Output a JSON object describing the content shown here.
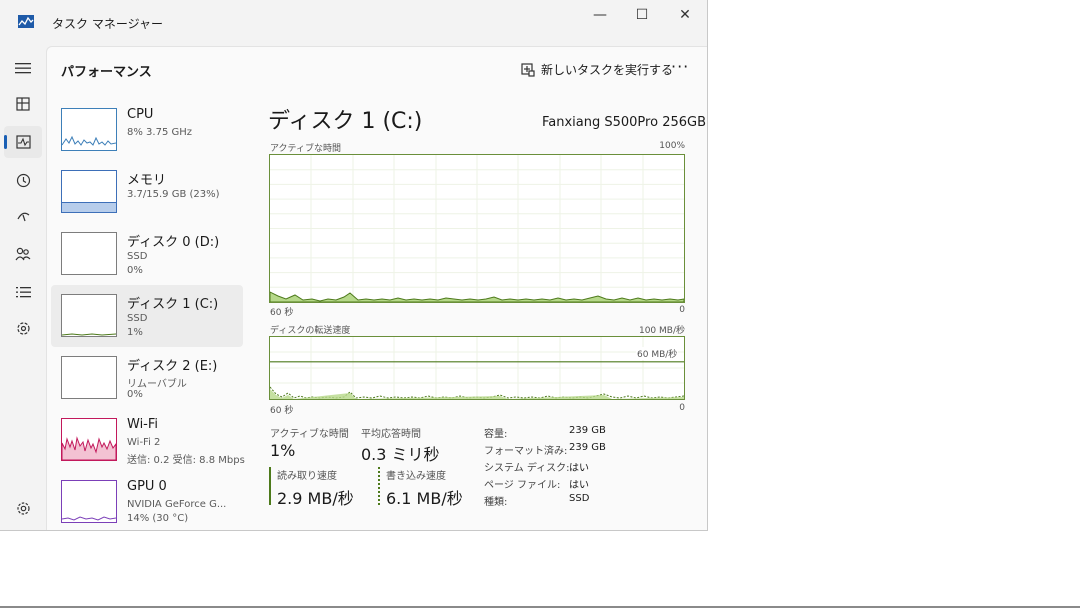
{
  "window": {
    "title": "タスク マネージャー",
    "minimize": "—",
    "maximize": "☐",
    "close": "✕"
  },
  "header": {
    "page_title": "パフォーマンス",
    "run_task_label": "新しいタスクを実行する",
    "more_label": "···"
  },
  "nav": {
    "items": [
      "menu-icon",
      "processes-icon",
      "performance-icon",
      "app-history-icon",
      "startup-icon",
      "users-icon",
      "details-icon",
      "services-icon",
      "settings-icon"
    ]
  },
  "sidebar": {
    "items": [
      {
        "name": "CPU",
        "sub1": "8%  3.75 GHz",
        "sub2": ""
      },
      {
        "name": "メモリ",
        "sub1": "3.7/15.9 GB (23%)",
        "sub2": ""
      },
      {
        "name": "ディスク 0 (D:)",
        "sub1": "SSD",
        "sub2": "0%"
      },
      {
        "name": "ディスク 1 (C:)",
        "sub1": "SSD",
        "sub2": "1%"
      },
      {
        "name": "ディスク 2 (E:)",
        "sub1": "リムーバブル",
        "sub2": "0%"
      },
      {
        "name": "Wi-Fi",
        "sub1": "Wi-Fi 2",
        "sub2": "送信: 0.2  受信: 8.8 Mbps"
      },
      {
        "name": "GPU 0",
        "sub1": "NVIDIA GeForce G...",
        "sub2": "14%  (30 °C)"
      }
    ]
  },
  "detail": {
    "title": "ディスク 1 (C:)",
    "model": "Fanxiang S500Pro 256GB",
    "graph1": {
      "label": "アクティブな時間",
      "max": "100%",
      "left": "60 秒",
      "right": "0"
    },
    "graph2": {
      "label": "ディスクの転送速度",
      "max": "100 MB/秒",
      "line_label": "60 MB/秒",
      "left": "60 秒",
      "right": "0"
    },
    "active_time_label": "アクティブな時間",
    "active_time_value": "1%",
    "response_label": "平均応答時間",
    "response_value": "0.3 ミリ秒",
    "read_label": "読み取り速度",
    "read_value": "2.9 MB/秒",
    "write_label": "書き込み速度",
    "write_value": "6.1 MB/秒",
    "props": [
      {
        "label": "容量:",
        "value": "239 GB"
      },
      {
        "label": "フォーマット済み:",
        "value": "239 GB"
      },
      {
        "label": "システム ディスク:",
        "value": "はい"
      },
      {
        "label": "ページ ファイル:",
        "value": "はい"
      },
      {
        "label": "種類:",
        "value": "SSD"
      }
    ]
  },
  "colors": {
    "disk_line": "#4d7a1b",
    "disk_fill": "#b6d88a",
    "memory": "#7fa7d9",
    "wifi": "#c2185b",
    "accent": "#1a5fb4"
  }
}
